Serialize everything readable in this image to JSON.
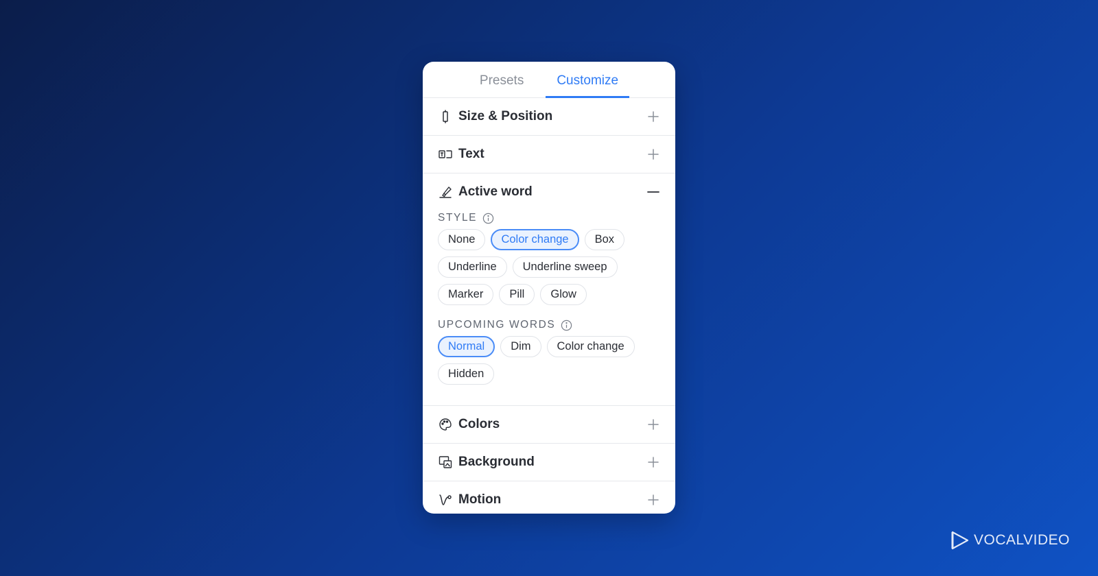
{
  "tabs": [
    {
      "label": "Presets",
      "active": false
    },
    {
      "label": "Customize",
      "active": true
    }
  ],
  "sections": {
    "size_position": {
      "title": "Size & Position",
      "icon": "resize-handle-icon"
    },
    "text": {
      "title": "Text",
      "icon": "text-box-icon"
    },
    "active_word": {
      "title": "Active word",
      "icon": "highlighter-icon",
      "style_label": "STYLE",
      "style_options": [
        "None",
        "Color change",
        "Box",
        "Underline",
        "Underline sweep",
        "Marker",
        "Pill",
        "Glow"
      ],
      "style_selected": "Color change",
      "upcoming_label": "UPCOMING WORDS",
      "upcoming_options": [
        "Normal",
        "Dim",
        "Color change",
        "Hidden"
      ],
      "upcoming_selected": "Normal"
    },
    "colors": {
      "title": "Colors",
      "icon": "palette-icon"
    },
    "background": {
      "title": "Background",
      "icon": "background-icon"
    },
    "motion": {
      "title": "Motion",
      "icon": "motion-curve-icon"
    }
  },
  "brand": {
    "name": "VOCALVIDEO",
    "accent": "#2f7bf5"
  }
}
